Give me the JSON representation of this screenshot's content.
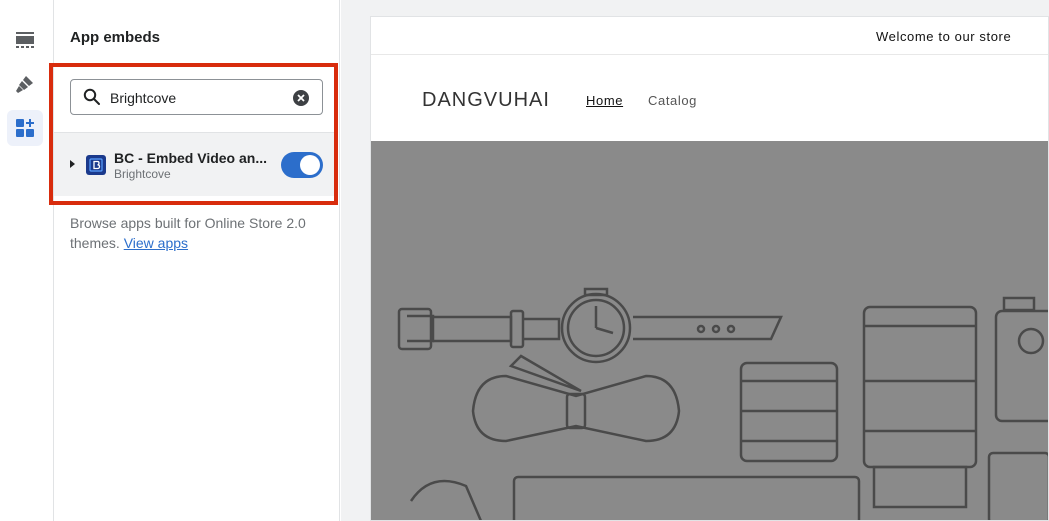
{
  "sidebar_rail": {
    "items": [
      {
        "icon": "sections-icon",
        "active": false
      },
      {
        "icon": "theme-settings-icon",
        "active": false
      },
      {
        "icon": "app-embeds-icon",
        "active": true
      }
    ]
  },
  "panel": {
    "title": "App embeds",
    "search": {
      "value": "Brightcove",
      "placeholder": "Search"
    },
    "apps": [
      {
        "name": "BC - Embed Video an...",
        "vendor": "Brightcove",
        "enabled": true
      }
    ],
    "browse_text": "Browse apps built for Online Store 2.0 themes.",
    "browse_link": "View apps",
    "highlight_color": "#d82c0d"
  },
  "preview": {
    "announcement": "Welcome to our store",
    "store_name": "DANGVUHAI",
    "nav": [
      "Home",
      "Catalog"
    ],
    "hero_color": "#8a8a8a"
  }
}
